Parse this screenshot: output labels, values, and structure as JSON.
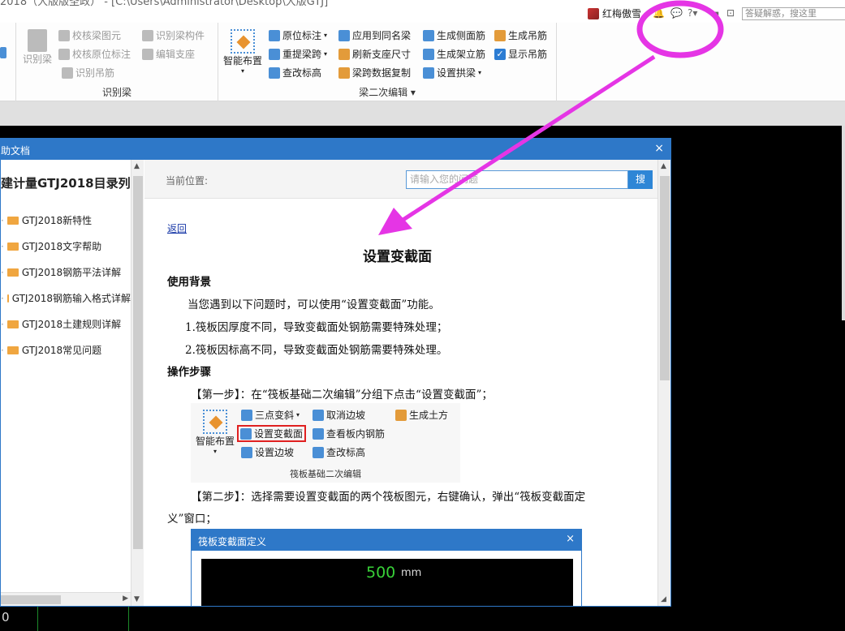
{
  "titlebar": {
    "title": "2018（大版版圣政） - [C:\\Users\\Administrator\\Desktop\\大版GTJ]",
    "user_name": "红梅傲雪",
    "search_placeholder": "答疑解惑，搜这里",
    "icons": [
      "bell-icon",
      "chat-icon",
      "help-icon",
      "minimize-icon",
      "restore-icon"
    ]
  },
  "ribbon": {
    "recognize_group": {
      "label": "识别梁",
      "big_button": "识别梁",
      "items": [
        "校核梁图元",
        "识别梁构件",
        "校核原位标注",
        "编辑支座",
        "识别吊筋"
      ]
    },
    "edit_group": {
      "label": "梁二次编辑 ▾",
      "big_button": "智能布置",
      "col1": [
        "原位标注",
        "重提梁跨",
        "查改标高"
      ],
      "col2": [
        "应用到同名梁",
        "刷新支座尺寸",
        "梁跨数据复制"
      ],
      "col3": [
        "生成侧面筋",
        "生成架立筋",
        "设置拱梁"
      ],
      "col4": [
        "生成吊筋",
        "显示吊筋"
      ]
    }
  },
  "help_window": {
    "title": "助文档",
    "close": "×",
    "tree_heading": "建计量GTJ2018目录列",
    "tree_items": [
      "GTJ2018新特性",
      "GTJ2018文字帮助",
      "GTJ2018钢筋平法详解",
      "GTJ2018钢筋输入格式详解",
      "GTJ2018土建规则详解",
      "GTJ2018常见问题"
    ],
    "location_label": "当前位置:",
    "search_placeholder": "请输入您的问题",
    "search_button": "搜",
    "back_link": "返回",
    "article": {
      "title": "设置变截面",
      "section1": "使用背景",
      "intro": "当您遇到以下问题时，可以使用“设置变截面”功能。",
      "point1": "1.筏板因厚度不同，导致变截面处钢筋需要特殊处理；",
      "point2": "2.筏板因标高不同，导致变截面处钢筋需要特殊处理。",
      "section2": "操作步骤",
      "step1": "【第一步】：在“筏板基础二次编辑”分组下点击“设置变截面”；",
      "step2a": "【第二步】：选择需要设置变截面的两个筏板图元，右键确认，弹出“筏板变截面定",
      "step2b": "义”窗口；"
    },
    "embed_ribbon": {
      "big_button": "智能布置",
      "items": [
        "三点变斜",
        "取消边坡",
        "生成土方",
        "设置变截面",
        "查看板内钢筋",
        "设置边坡",
        "查改标高"
      ],
      "group_label": "筏板基础二次编辑"
    },
    "embed_dialog": {
      "title": "筏板变截面定义",
      "close": "×",
      "dimension": "500",
      "unit": "mm"
    }
  },
  "status": {
    "value": "0"
  },
  "colors": {
    "annotation": "#e535e5",
    "titlebar_blue": "#2e78c8",
    "highlight_red": "#e02020"
  }
}
